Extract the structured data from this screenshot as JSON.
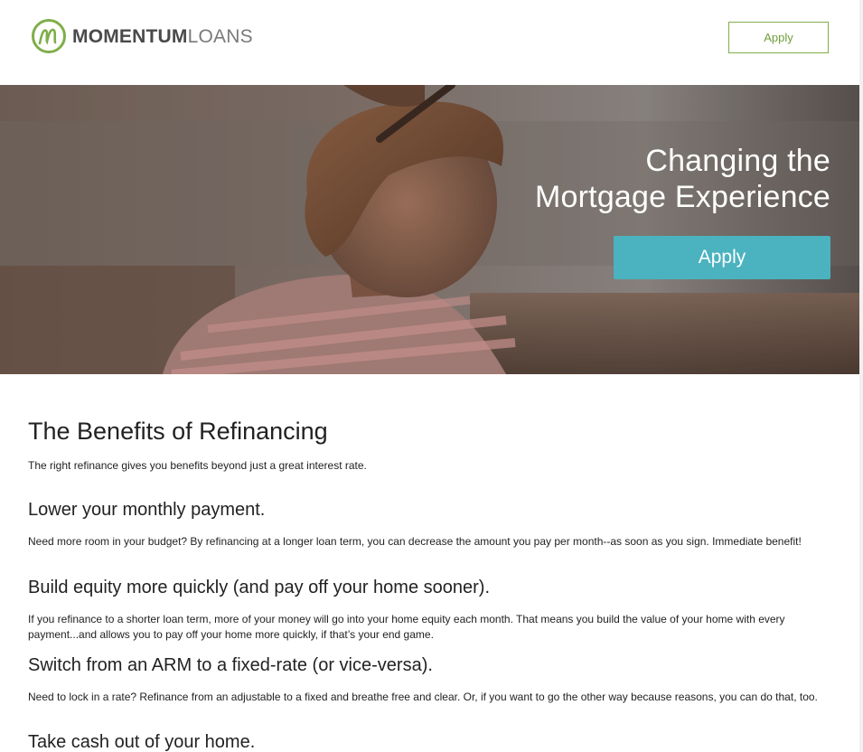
{
  "header": {
    "logo_bold": "MOMENTUM",
    "logo_light": "LOANS",
    "apply_label": "Apply",
    "brand_green": "#7fae4a"
  },
  "hero": {
    "title_line1": "Changing the",
    "title_line2": "Mortgage Experience",
    "apply_label": "Apply",
    "accent": "#4bb3bf"
  },
  "content": {
    "title": "The Benefits of Refinancing",
    "intro": "The right refinance gives you benefits beyond just a great interest rate.",
    "benefits": [
      {
        "title": "Lower your monthly payment.",
        "text": "Need more room in your budget? By refinancing at a longer loan term, you can decrease the amount you pay per month--as soon as you sign. Immediate benefit!"
      },
      {
        "title": "Build equity more quickly (and pay off your home sooner).",
        "text": "If you refinance to a shorter loan term, more of your money will go into your home equity each month. That means you build the value of your home with every payment...and allows you to pay off your home more quickly, if that’s your end game."
      },
      {
        "title": "Switch from an ARM to a fixed-rate (or vice-versa).",
        "text": "Need to lock in a rate? Refinance from an adjustable to a fixed and breathe free and clear. Or, if you want to go the other way because reasons, you can do that, too."
      },
      {
        "title": "Take cash out of your home.",
        "text": ""
      }
    ]
  }
}
